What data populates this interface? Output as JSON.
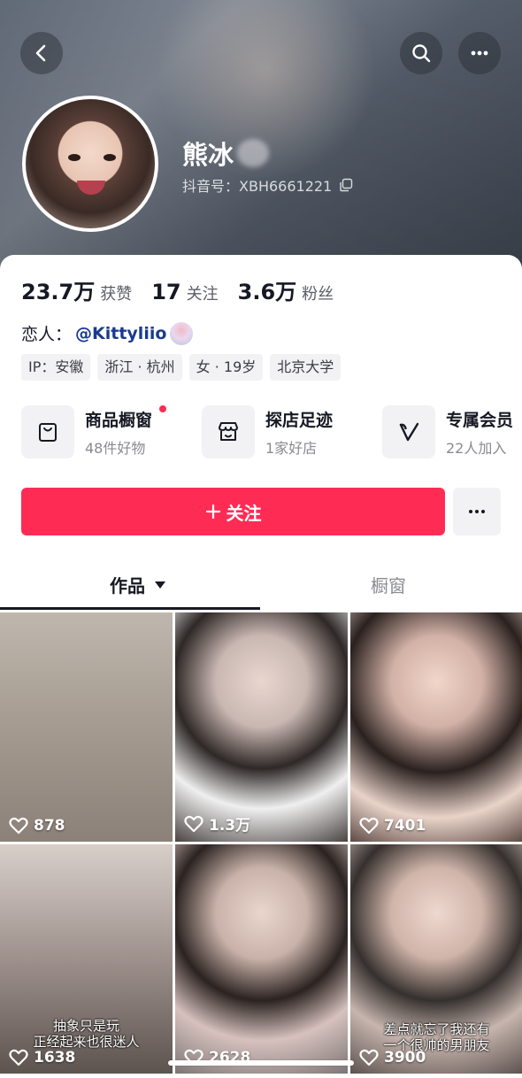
{
  "profile": {
    "nickname": "熊冰",
    "douyin_id": "抖音号：XBH6661221"
  },
  "stats": [
    {
      "num": "23.7万",
      "label": "获赞"
    },
    {
      "num": "17",
      "label": "关注"
    },
    {
      "num": "3.6万",
      "label": "粉丝"
    }
  ],
  "lover": {
    "prefix": "恋人：",
    "handle": "@Kittyliio"
  },
  "tags": [
    "IP：安徽",
    "浙江 · 杭州",
    "女 · 19岁",
    "北京大学"
  ],
  "shortcuts": [
    {
      "title": "商品橱窗",
      "subtitle": "48件好物",
      "icon": "shopping-bag-icon"
    },
    {
      "title": "探店足迹",
      "subtitle": "1家好店",
      "icon": "store-icon"
    },
    {
      "title": "专属会员",
      "subtitle": "22人加入",
      "icon": "v-badge-icon"
    }
  ],
  "actions": {
    "follow_label": "关注"
  },
  "tabs": {
    "works": "作品",
    "showcase": "橱窗"
  },
  "videos": [
    {
      "likes": "878",
      "caption": ""
    },
    {
      "likes": "1.3万",
      "caption": ""
    },
    {
      "likes": "7401",
      "caption": ""
    },
    {
      "likes": "1638",
      "caption": "抽象只是玩\n正经起来也很迷人"
    },
    {
      "likes": "2628",
      "caption": ""
    },
    {
      "likes": "3900",
      "caption": "差点就忘了我还有\n一个很帅的男朋友"
    }
  ],
  "colors": {
    "accent": "#fe2c55",
    "text": "#161823",
    "muted": "#8a8b91",
    "chip": "#f2f2f4"
  }
}
